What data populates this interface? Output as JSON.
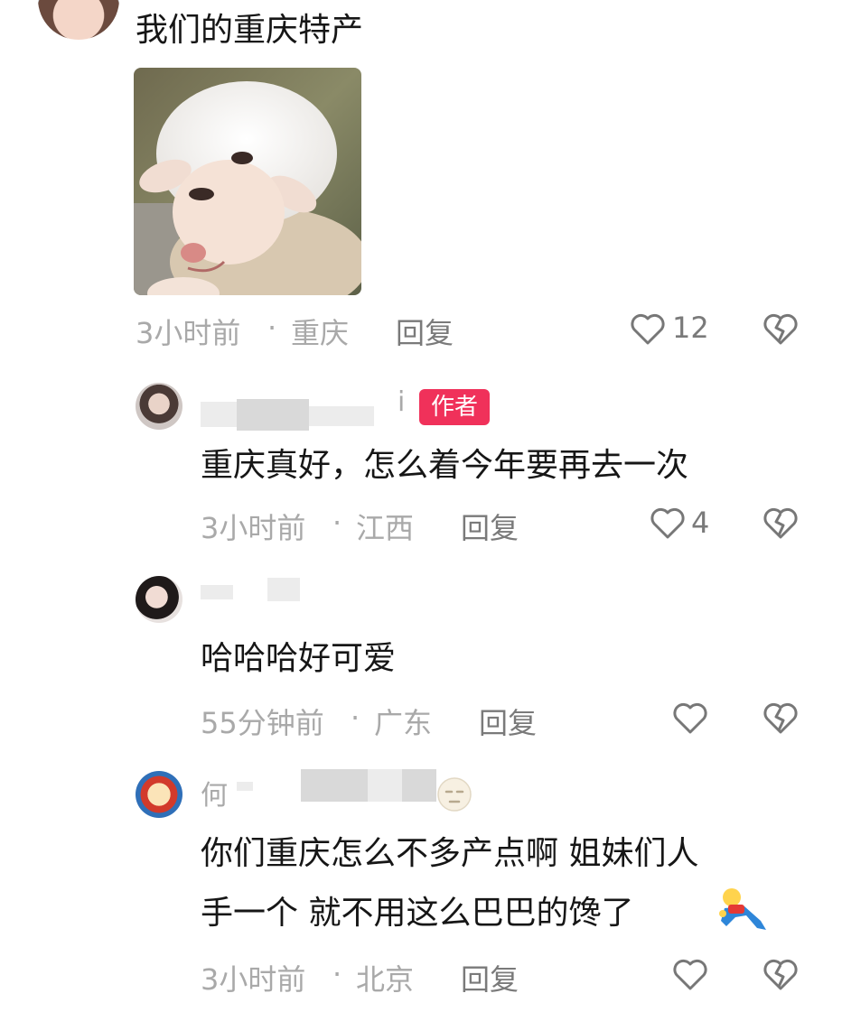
{
  "post": {
    "caption": "我们的重庆特产",
    "time": "3小时前",
    "location": "重庆",
    "reply_label": "回复",
    "like_count": "12",
    "image_icon": "lamb-photo"
  },
  "replies": [
    {
      "author_visible_suffix": "i",
      "author_badge": "作者",
      "text": "重庆真好，怎么着今年要再去一次",
      "time": "3小时前",
      "location": "江西",
      "reply_label": "回复",
      "like_count": "4"
    },
    {
      "text": "哈哈哈好可爱",
      "time": "55分钟前",
      "location": "广东",
      "reply_label": "回复",
      "like_count": ""
    },
    {
      "author_visible_prefix": "何",
      "text_line1": "你们重庆怎么不多产点啊 姐妹们人",
      "text_line2": "手一个 就不用这么巴巴的馋了",
      "emoji_icon": "crawling-emoji",
      "time": "3小时前",
      "location": "北京",
      "reply_label": "回复",
      "like_count": ""
    }
  ],
  "separator": "·",
  "icons": [
    "heart-outline-icon",
    "broken-heart-icon"
  ],
  "colors": {
    "badge": "#f0315a",
    "meta": "#a9a9a9",
    "text": "#161616"
  }
}
